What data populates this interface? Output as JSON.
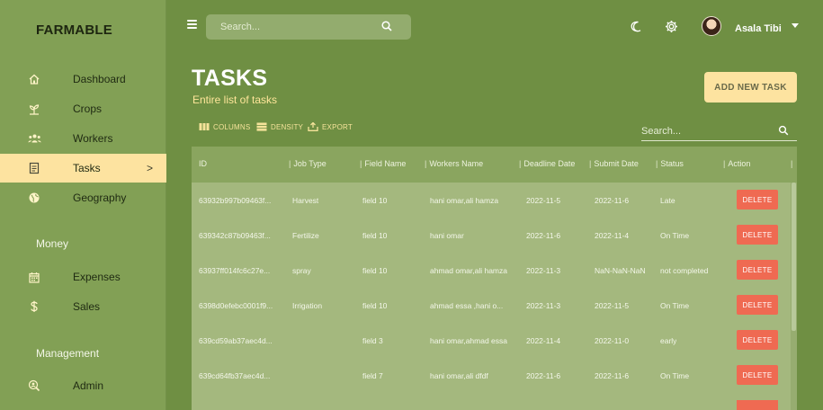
{
  "brand": "FARMABLE",
  "sidebar": {
    "items": [
      {
        "label": "Dashboard",
        "icon": "home-icon"
      },
      {
        "label": "Crops",
        "icon": "sprout-icon"
      },
      {
        "label": "Workers",
        "icon": "people-icon"
      },
      {
        "label": "Tasks",
        "icon": "clipboard-icon",
        "active": true,
        "chevron": ">"
      },
      {
        "label": "Geography",
        "icon": "globe-icon"
      }
    ],
    "money_label": "Money",
    "money_items": [
      {
        "label": "Expenses",
        "icon": "calendar-icon"
      },
      {
        "label": "Sales",
        "icon": "dollar-icon"
      }
    ],
    "management_label": "Management",
    "management_items": [
      {
        "label": "Admin",
        "icon": "admin-icon"
      }
    ]
  },
  "topbar": {
    "search_placeholder": "Search...",
    "user_name": "Asala Tibi"
  },
  "page": {
    "title": "TASKS",
    "subtitle": "Entire list of tasks",
    "add_button": "ADD NEW TASK"
  },
  "toolbar": {
    "columns": "COLUMNS",
    "density": "DENSITY",
    "export": "EXPORT",
    "search_placeholder": "Search..."
  },
  "table": {
    "headers": [
      "ID",
      "Job Type",
      "Field Name",
      "Workers Name",
      "Deadline Date",
      "Submit Date",
      "Status",
      "Action"
    ],
    "delete_label": "DELETE",
    "rows": [
      [
        "63932b997b09463f...",
        "Harvest",
        "field 10",
        "hani omar,ali hamza",
        "2022-11-5",
        "2022-11-6",
        "Late"
      ],
      [
        "639342c87b09463f...",
        "Fertilize",
        "field 10",
        "hani omar",
        "2022-11-6",
        "2022-11-4",
        "On Time"
      ],
      [
        "63937ff014fc6c27e...",
        "spray",
        "field 10",
        "ahmad omar,ali hamza",
        "2022-11-3",
        "NaN-NaN-NaN",
        "not completed"
      ],
      [
        "6398d0efebc0001f9...",
        "Irrigation",
        "field 10",
        "ahmad essa ,hani o...",
        "2022-11-3",
        "2022-11-5",
        "On Time"
      ],
      [
        "639cd59ab37aec4d...",
        "",
        "field 3",
        "hani omar,ahmad essa",
        "2022-11-4",
        "2022-11-0",
        "early"
      ],
      [
        "639cd64fb37aec4d...",
        "",
        "field 7",
        "hani omar,ali dfdf",
        "2022-11-6",
        "2022-11-6",
        "On Time"
      ]
    ]
  },
  "colors": {
    "background": "#6f8f43",
    "sidebar": "#82a055",
    "active_item": "#fde3a0",
    "delete": "#ef6a52",
    "accent_text": "#ffe69a"
  }
}
